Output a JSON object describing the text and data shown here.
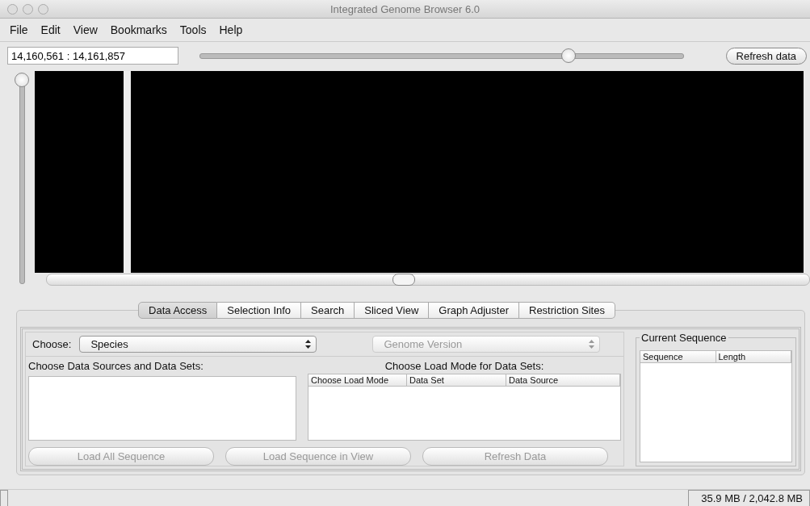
{
  "window": {
    "title": "Integrated Genome Browser 6.0"
  },
  "menu": [
    "File",
    "Edit",
    "View",
    "Bookmarks",
    "Tools",
    "Help"
  ],
  "toolbar": {
    "location": "14,160,561 : 14,161,857",
    "zoom": {
      "level": 0.76
    },
    "refresh_button": "Refresh data"
  },
  "tabs": [
    {
      "label": "Data Access",
      "selected": true
    },
    {
      "label": "Selection Info",
      "selected": false
    },
    {
      "label": "Search",
      "selected": false
    },
    {
      "label": "Sliced View",
      "selected": false
    },
    {
      "label": "Graph Adjuster",
      "selected": false
    },
    {
      "label": "Restriction Sites",
      "selected": false
    }
  ],
  "data_access": {
    "choose_label": "Choose:",
    "species": {
      "value": "Species",
      "disabled": false
    },
    "genome_version": {
      "value": "Genome Version",
      "disabled": true
    },
    "sources_label": "Choose Data Sources and Data Sets:",
    "load_mode_label": "Choose Load Mode for Data Sets:",
    "load_mode_columns": [
      "Choose Load Mode",
      "Data Set",
      "Data Source"
    ],
    "buttons": [
      {
        "label": "Load All Sequence",
        "disabled": true
      },
      {
        "label": "Load Sequence in View",
        "disabled": true
      },
      {
        "label": "Refresh Data",
        "disabled": true
      }
    ],
    "current_sequence": {
      "title": "Current Sequence",
      "columns": [
        "Sequence",
        "Length"
      ]
    }
  },
  "status_bar": {
    "memory": "35.9 MB / 2,042.8 MB"
  }
}
